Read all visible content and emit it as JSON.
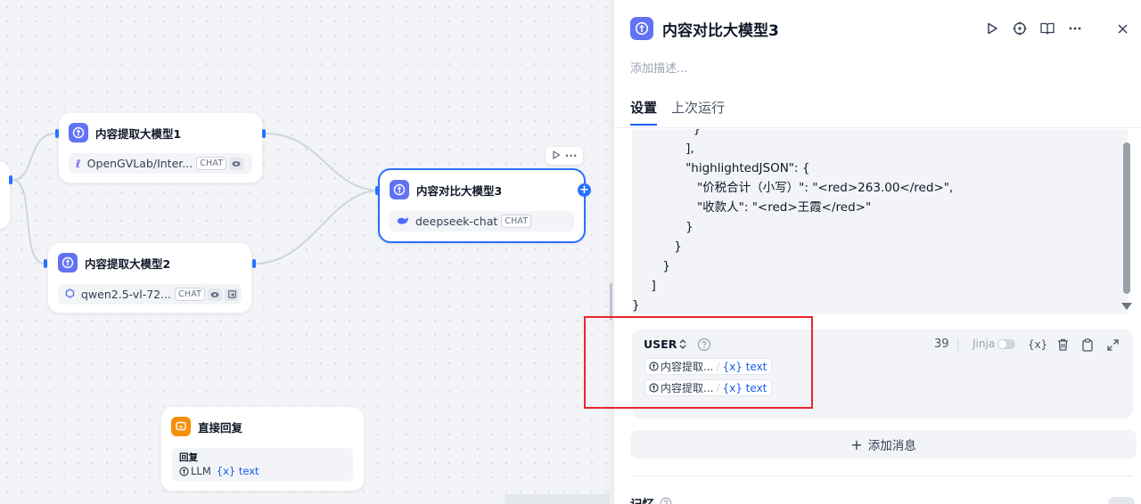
{
  "canvas": {
    "nodes": {
      "extract1": {
        "title": "内容提取大模型1",
        "model": "OpenGVLab/Inter...",
        "chip": "CHAT"
      },
      "extract2": {
        "title": "内容提取大模型2",
        "model": "qwen2.5-vl-72...",
        "chip": "CHAT"
      },
      "compare3": {
        "title": "内容对比大模型3",
        "model": "deepseek-chat",
        "chip": "CHAT"
      },
      "reply": {
        "title": "直接回复",
        "label": "回复",
        "source": "LLM",
        "var": "{x} text"
      }
    },
    "toolbar_more": "···",
    "plus": "+"
  },
  "panel": {
    "title": "内容对比大模型3",
    "description_placeholder": "添加描述...",
    "tabs": [
      {
        "label": "设置"
      },
      {
        "label": "上次运行"
      }
    ],
    "code_lines": [
      "                }",
      "              ],",
      "              \"highlightedJSON\": {",
      "                 \"价税合计（小写）\": \"<red>263.00</red>\",",
      "                 \"收款人\": \"<red>王霞</red>\"",
      "              }",
      "           }",
      "        }",
      "     ]",
      "}"
    ],
    "user": {
      "role": "USER",
      "token_count": "39",
      "jinja_label": "Jinja",
      "var_tool": "{x}",
      "vars": [
        {
          "source": "内容提取...",
          "var": "{x} text"
        },
        {
          "source": "内容提取...",
          "var": "{x} text"
        }
      ]
    },
    "add_message": "添加消息",
    "memory_label": "记忆"
  }
}
